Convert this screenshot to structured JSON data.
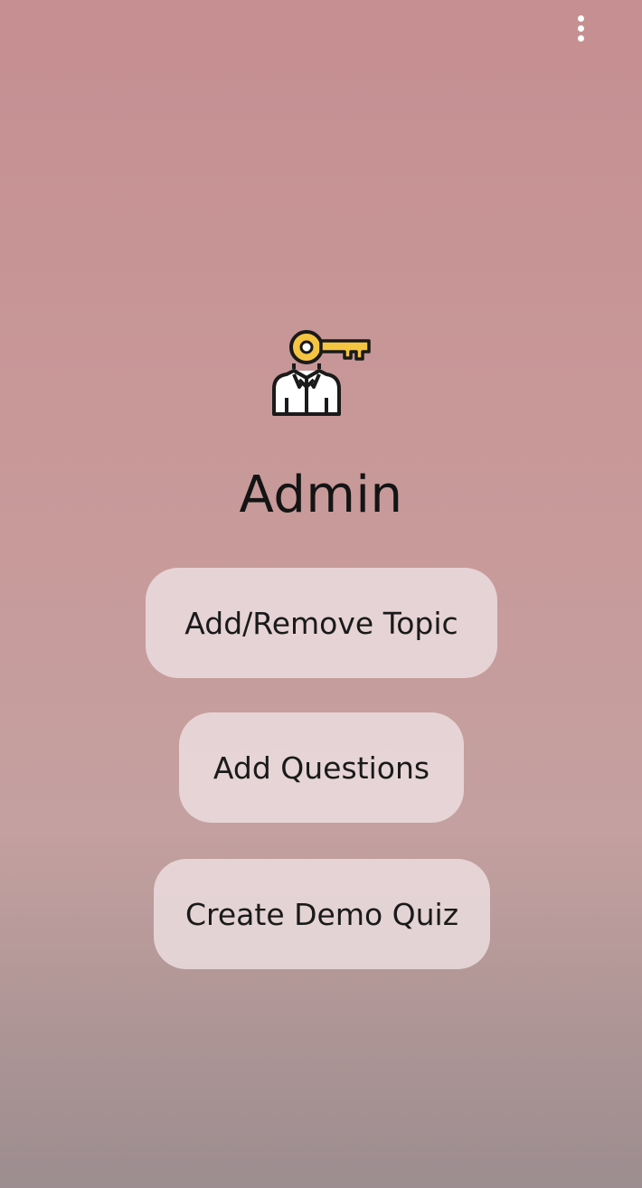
{
  "toolbar": {
    "overflow_icon": "more-vert-icon"
  },
  "hero": {
    "icon": "admin-key-person-icon",
    "icon_colors": {
      "key": "#f5c542",
      "outline": "#1a1a1a"
    },
    "title": "Admin"
  },
  "actions": {
    "add_remove_topic": "Add/Remove Topic",
    "add_questions": "Add Questions",
    "create_demo_quiz": "Create Demo Quiz"
  },
  "colors": {
    "background_top": "#c68f92",
    "background_bottom": "#9c8d90",
    "button_fill": "#ecdee0",
    "text": "#1a1a1a"
  }
}
